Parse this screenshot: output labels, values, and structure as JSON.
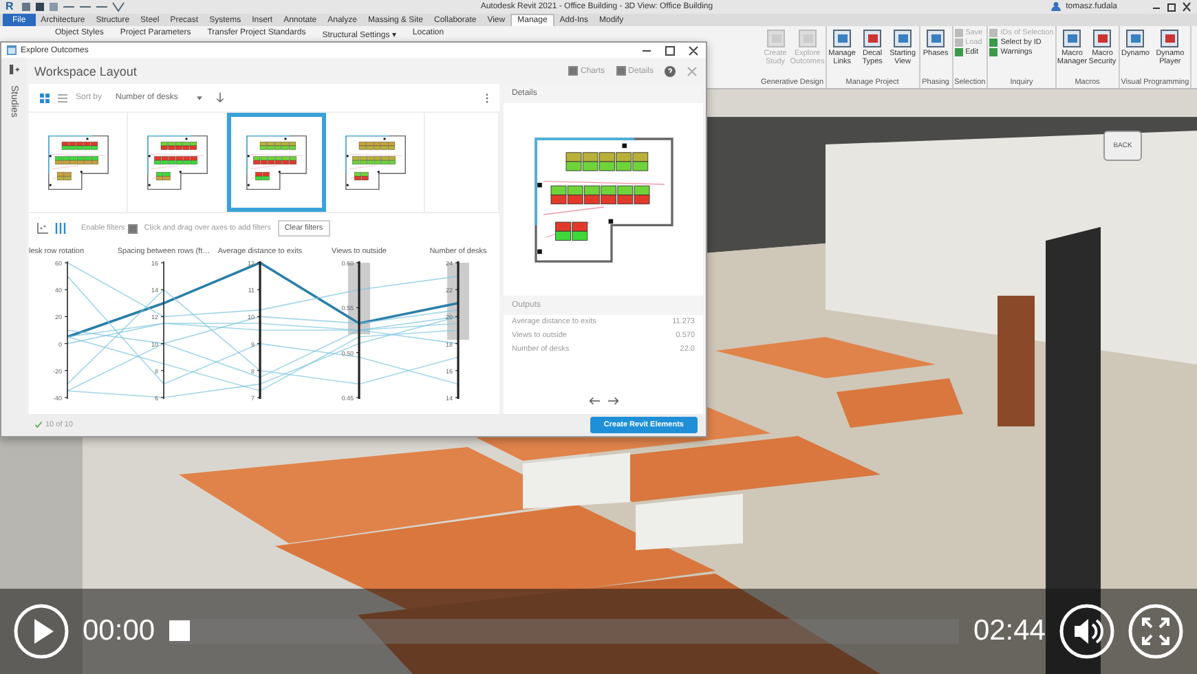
{
  "video_frame": {
    "logo": "R",
    "title": "Autodesk Revit 2021 - Office Building - 3D View: Office Building",
    "user": "tomasz.fudala",
    "tabs": [
      {
        "label": "File",
        "kind": "file",
        "selected": false
      },
      {
        "label": "Architecture",
        "kind": "tab",
        "selected": false
      },
      {
        "label": "Structure",
        "kind": "tab",
        "selected": false
      },
      {
        "label": "Steel",
        "kind": "tab",
        "selected": false
      },
      {
        "label": "Precast",
        "kind": "tab",
        "selected": false
      },
      {
        "label": "Systems",
        "kind": "tab",
        "selected": false
      },
      {
        "label": "Insert",
        "kind": "tab",
        "selected": false
      },
      {
        "label": "Annotate",
        "kind": "tab",
        "selected": false
      },
      {
        "label": "Analyze",
        "kind": "tab",
        "selected": false
      },
      {
        "label": "Massing & Site",
        "kind": "tab",
        "selected": false
      },
      {
        "label": "Collaborate",
        "kind": "tab",
        "selected": false
      },
      {
        "label": "View",
        "kind": "tab",
        "selected": false
      },
      {
        "label": "Manage",
        "kind": "tab",
        "selected": true
      },
      {
        "label": "Add-Ins",
        "kind": "tab",
        "selected": false
      },
      {
        "label": "Modify",
        "kind": "tab",
        "selected": false
      }
    ],
    "ribbon": {
      "top_tools": [
        "Object Styles",
        "Project Parameters",
        "Transfer Project Standards",
        "Structural Settings ▾",
        "Location"
      ],
      "panels": [
        {
          "title": "Generative Design",
          "tools": [
            {
              "label": "Create Study",
              "kind": "large",
              "disabled": true
            },
            {
              "label": "Explore Outcomes",
              "kind": "large",
              "disabled": true
            }
          ]
        },
        {
          "title": "Manage Project",
          "tools": [
            {
              "label": "Manage Links",
              "kind": "large",
              "disabled": false
            },
            {
              "label": "Decal Types",
              "kind": "large",
              "disabled": false
            },
            {
              "label": "Starting View",
              "kind": "large",
              "disabled": false
            }
          ]
        },
        {
          "title": "Phasing",
          "tools": [
            {
              "label": "Phases",
              "kind": "large",
              "disabled": false
            }
          ]
        },
        {
          "title": "Selection",
          "tools": [
            {
              "label": "Save",
              "kind": "small",
              "disabled": true
            },
            {
              "label": "Load",
              "kind": "small",
              "disabled": true
            },
            {
              "label": "Edit",
              "kind": "small",
              "disabled": false
            }
          ]
        },
        {
          "title": "Inquiry",
          "tools": [
            {
              "label": "IDs of Selection",
              "kind": "small",
              "disabled": true
            },
            {
              "label": "Select by ID",
              "kind": "small",
              "disabled": false
            },
            {
              "label": "Warnings",
              "kind": "small",
              "disabled": false
            }
          ]
        },
        {
          "title": "Macros",
          "tools": [
            {
              "label": "Macro Manager",
              "kind": "large",
              "disabled": false
            },
            {
              "label": "Macro Security",
              "kind": "large",
              "disabled": false
            }
          ]
        },
        {
          "title": "Visual Programming",
          "tools": [
            {
              "label": "Dynamo",
              "kind": "large",
              "disabled": false
            },
            {
              "label": "Dynamo Player",
              "kind": "large",
              "disabled": false
            }
          ]
        }
      ]
    },
    "viewcube_label": "BACK",
    "dialog": {
      "title": "Explore Outcomes",
      "side_label": "Studies",
      "heading": "Workspace Layout",
      "toggles": [
        {
          "label": "Charts",
          "checked": true
        },
        {
          "label": "Details",
          "checked": true
        }
      ],
      "view_modes": [
        {
          "kind": "grid",
          "selected": true
        },
        {
          "kind": "list",
          "selected": false
        }
      ],
      "sort_label": "Sort by",
      "sort_value": "Number of desks",
      "thumbnails": [
        {
          "selected": false
        },
        {
          "selected": false
        },
        {
          "selected": true
        },
        {
          "selected": false
        }
      ],
      "chart_modes": [
        {
          "kind": "scatter",
          "selected": false
        },
        {
          "kind": "parallel",
          "selected": true
        }
      ],
      "filter_label": "Enable filters",
      "filters_enabled": true,
      "filter_hint": "Click and drag over axes to add filters",
      "clear_button": "Clear filters",
      "axes": [
        {
          "title": "lesk row rotation",
          "ticks": [
            "60",
            "40",
            "20",
            "0",
            "-20",
            "-40"
          ]
        },
        {
          "title": "Spacing between rows (ft…",
          "ticks": [
            "16",
            "14",
            "12",
            "10",
            "8",
            "6"
          ]
        },
        {
          "title": "Average distance to exits",
          "ticks": [
            "12",
            "11",
            "10",
            "9",
            "8",
            "7"
          ]
        },
        {
          "title": "Views to outside",
          "ticks": [
            "0.60",
            "0.55",
            "0.50",
            "0.45"
          ]
        },
        {
          "title": "Number of desks",
          "ticks": [
            "24",
            "22",
            "20",
            "18",
            "16",
            "14"
          ]
        }
      ],
      "count": "10 of 10",
      "details": {
        "title": "Details",
        "outputs_title": "Outputs",
        "outputs": [
          {
            "label": "Average distance to exits",
            "value": "11.273"
          },
          {
            "label": "Views to outside",
            "value": "0.570"
          },
          {
            "label": "Number of desks",
            "value": "22.0"
          }
        ],
        "action_button": "Create Revit Elements"
      }
    }
  },
  "player": {
    "elapsed": "00:00",
    "level": 0,
    "duration": "02:44"
  }
}
